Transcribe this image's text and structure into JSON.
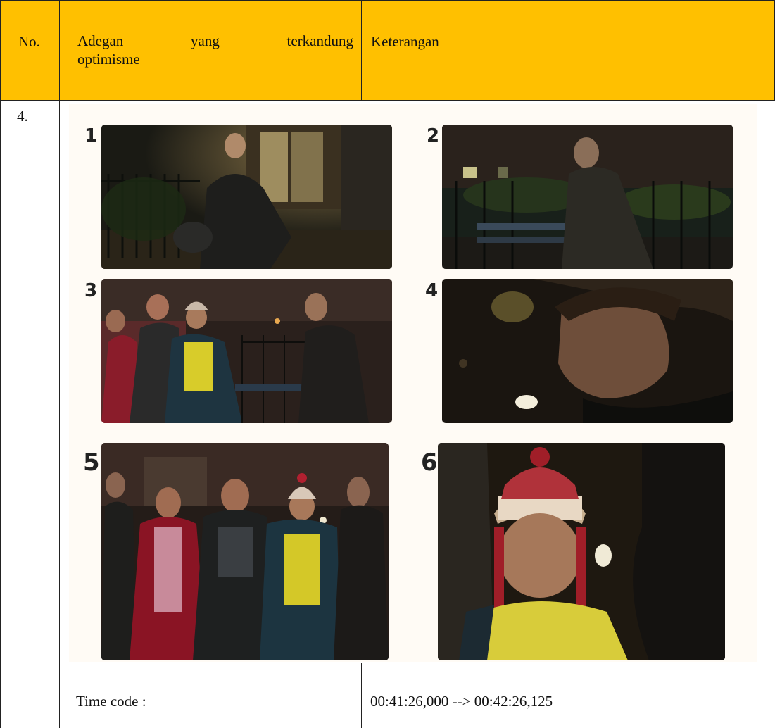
{
  "table": {
    "header": {
      "no": "No.",
      "scene_words": [
        "Adegan",
        "yang",
        "terkandung"
      ],
      "scene_line2": "optimisme",
      "description": "Keterangan"
    },
    "row": {
      "no": "4.",
      "frames": [
        "1",
        "2",
        "3",
        "4",
        "5",
        "6"
      ],
      "time_label": "Time code :",
      "time_value": "00:41:26,000 --> 00:42:26,125"
    }
  },
  "colors": {
    "header_fill": "#FFC000",
    "panel_fill": "#FFFBF5",
    "border": "#222222"
  }
}
